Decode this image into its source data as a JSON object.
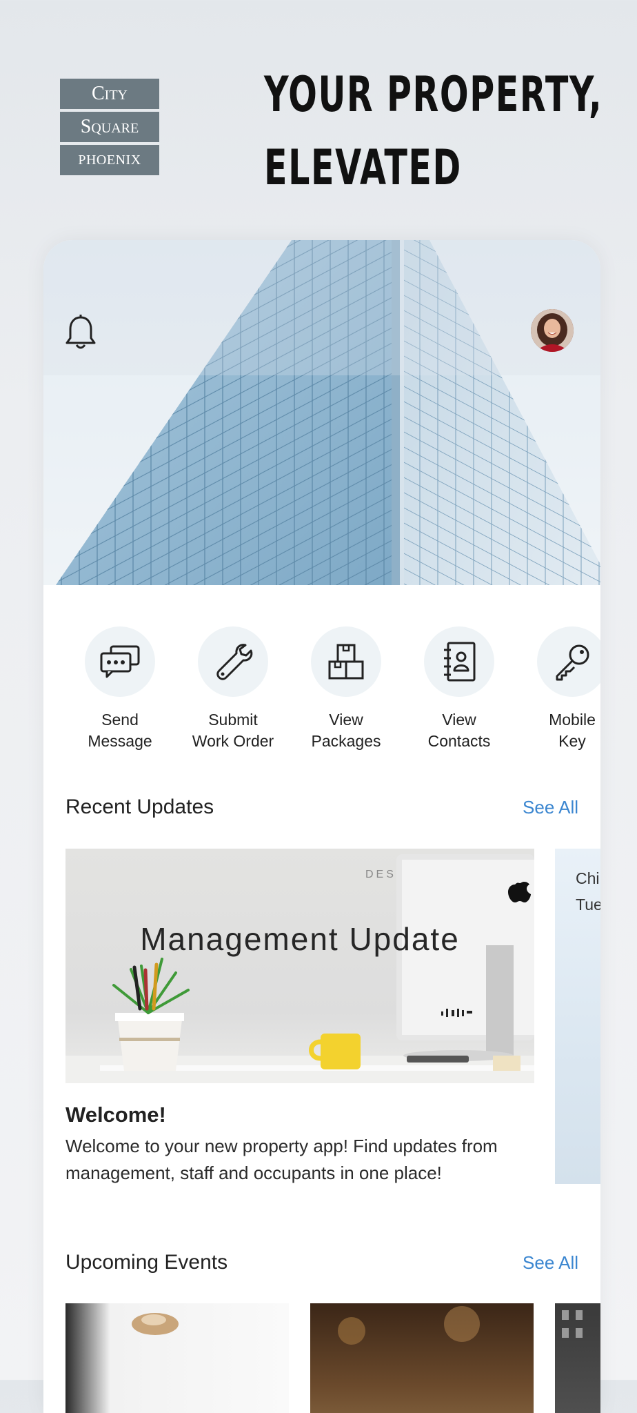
{
  "logo": {
    "line1": "City",
    "line2": "Square",
    "line3": "PHOENIX"
  },
  "headline": {
    "line1": "YOUR PROPERTY,",
    "line2": "ELEVATED"
  },
  "header": {
    "bell_icon": "bell-icon",
    "avatar": "user-avatar"
  },
  "quick_actions": [
    {
      "line1": "Send",
      "line2": "Message",
      "icon": "chat-bubbles-icon"
    },
    {
      "line1": "Submit",
      "line2": "Work Order",
      "icon": "wrench-icon"
    },
    {
      "line1": "View",
      "line2": "Packages",
      "icon": "packages-icon"
    },
    {
      "line1": "View",
      "line2": "Contacts",
      "icon": "contacts-book-icon"
    },
    {
      "line1": "Mobile",
      "line2": "Key",
      "icon": "key-icon"
    }
  ],
  "recent_updates": {
    "title": "Recent Updates",
    "see_all": "See All",
    "card": {
      "image_title": "Management Update",
      "headline": "Welcome!",
      "body": "Welcome to your new property app! Find updates from management, staff and occupants in one place!"
    },
    "next_card": {
      "line1": "Chi",
      "line2": "Tue"
    }
  },
  "upcoming_events": {
    "title": "Upcoming Events",
    "see_all": "See All"
  },
  "colors": {
    "accent": "#3b86d0",
    "logo_bg": "#6c7a82",
    "icon_circle": "#eef3f6"
  }
}
